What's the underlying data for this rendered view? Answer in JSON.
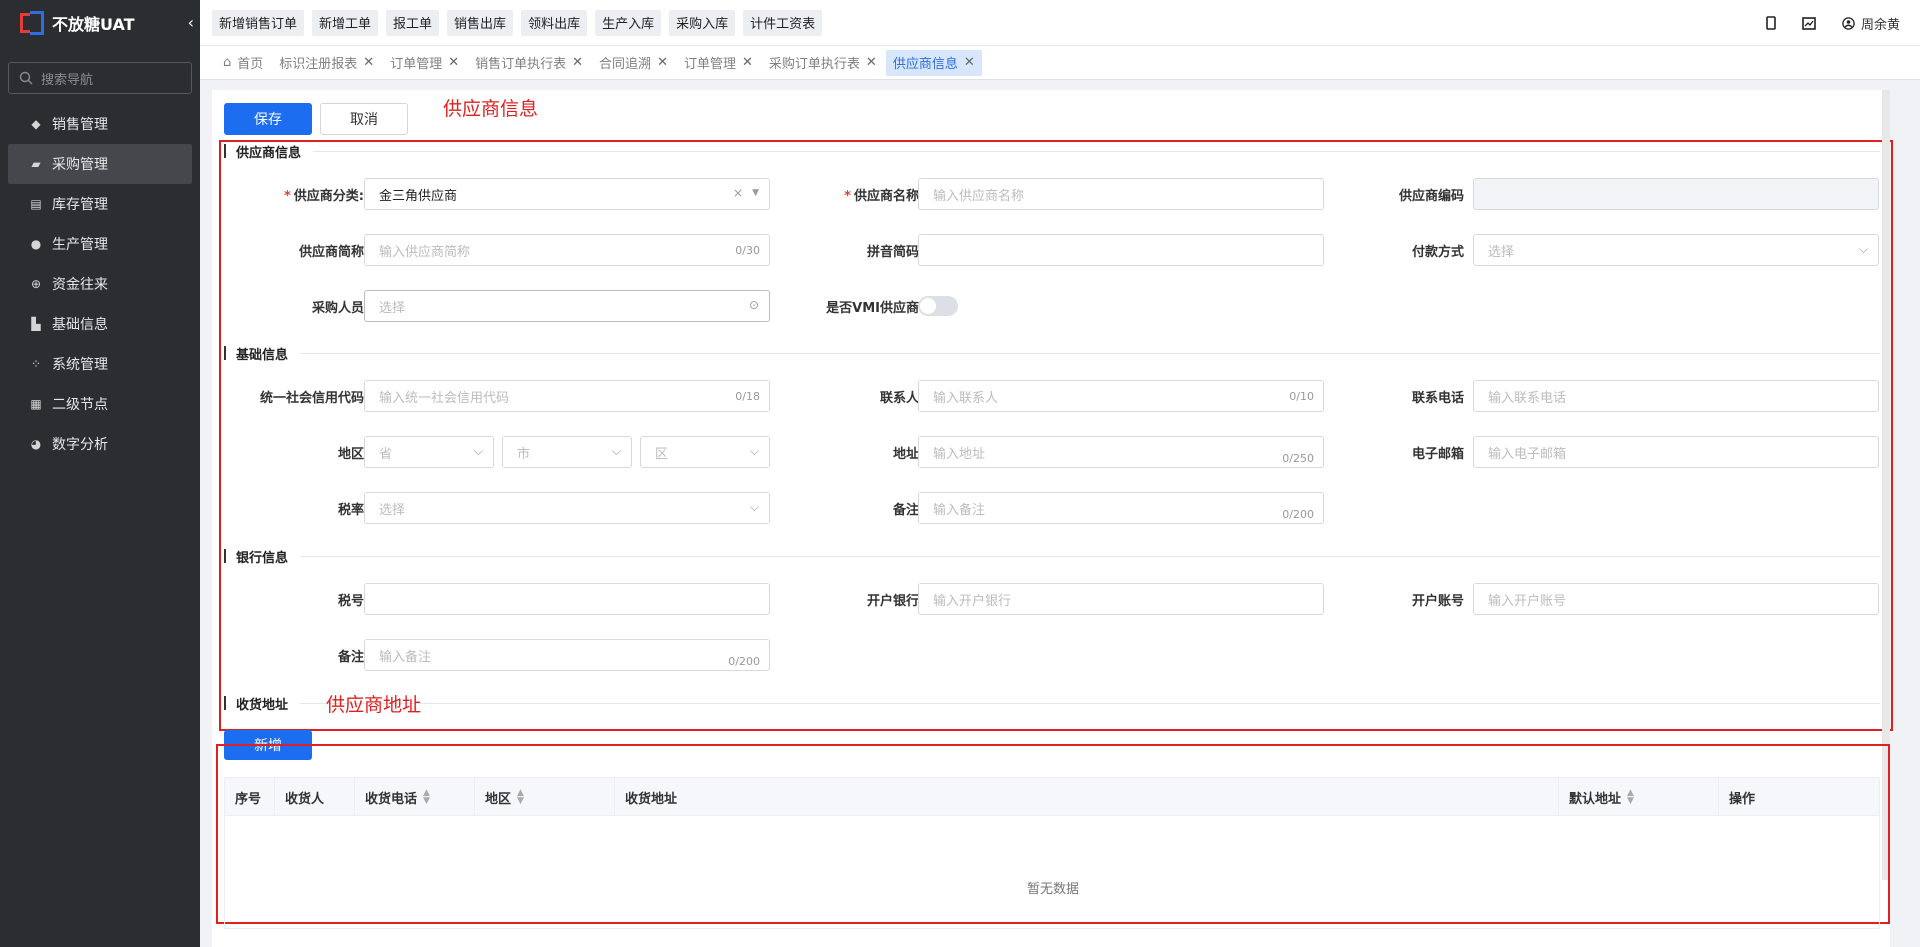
{
  "sidebar": {
    "logo_text": "不放糖UAT",
    "collapse_icon": "‹",
    "search_placeholder": "搜索导航",
    "items": [
      {
        "label": "销售管理",
        "icon": "tag-icon"
      },
      {
        "label": "采购管理",
        "icon": "cart-icon",
        "active": true
      },
      {
        "label": "库存管理",
        "icon": "warehouse-icon"
      },
      {
        "label": "生产管理",
        "icon": "production-icon"
      },
      {
        "label": "资金往来",
        "icon": "money-icon"
      },
      {
        "label": "基础信息",
        "icon": "chart-icon"
      },
      {
        "label": "系统管理",
        "icon": "grid-icon"
      },
      {
        "label": "二级节点",
        "icon": "document-icon"
      },
      {
        "label": "数字分析",
        "icon": "pie-icon"
      }
    ]
  },
  "topbar": {
    "quick_buttons": [
      "新增销售订单",
      "新增工单",
      "报工单",
      "销售出库",
      "领料出库",
      "生产入库",
      "采购入库",
      "计件工资表"
    ],
    "user_name": "周余黄"
  },
  "tabs": [
    {
      "label": "首页",
      "closable": false
    },
    {
      "label": "标识注册报表",
      "closable": true
    },
    {
      "label": "订单管理",
      "closable": true
    },
    {
      "label": "销售订单执行表",
      "closable": true
    },
    {
      "label": "合同追溯",
      "closable": true
    },
    {
      "label": "订单管理",
      "closable": true
    },
    {
      "label": "采购订单执行表",
      "closable": true
    },
    {
      "label": "供应商信息",
      "closable": true,
      "active": true
    }
  ],
  "toolbar": {
    "save_label": "保存",
    "cancel_label": "取消"
  },
  "annotations": {
    "top": "供应商信息",
    "address": "供应商地址"
  },
  "sections": {
    "supplier": "供应商信息",
    "basic": "基础信息",
    "bank": "银行信息",
    "address": "收货地址"
  },
  "form": {
    "category": {
      "label": "供应商分类:",
      "value": "金三角供应商",
      "clear": "×"
    },
    "name": {
      "label": "供应商名称",
      "placeholder": "输入供应商名称"
    },
    "code": {
      "label": "供应商编码"
    },
    "short_name": {
      "label": "供应商简称",
      "placeholder": "输入供应商简称",
      "count": "0/30"
    },
    "pinyin": {
      "label": "拼音简码"
    },
    "payment": {
      "label": "付款方式",
      "placeholder": "选择"
    },
    "buyer": {
      "label": "采购人员",
      "placeholder": "选择"
    },
    "vmi": {
      "label": "是否VMI供应商",
      "value": false
    },
    "credit_code": {
      "label": "统一社会信用代码",
      "placeholder": "输入统一社会信用代码",
      "count": "0/18"
    },
    "contact": {
      "label": "联系人",
      "placeholder": "输入联系人",
      "count": "0/10"
    },
    "phone": {
      "label": "联系电话",
      "placeholder": "输入联系电话"
    },
    "region": {
      "label": "地区",
      "province": "省",
      "city": "市",
      "district": "区"
    },
    "address": {
      "label": "地址",
      "placeholder": "输入地址",
      "count": "0/250"
    },
    "email": {
      "label": "电子邮箱",
      "placeholder": "输入电子邮箱"
    },
    "tax_rate": {
      "label": "税率",
      "placeholder": "选择"
    },
    "remark": {
      "label": "备注",
      "placeholder": "输入备注",
      "count": "0/200"
    },
    "tax_no": {
      "label": "税号"
    },
    "bank": {
      "label": "开户银行",
      "placeholder": "输入开户银行"
    },
    "account": {
      "label": "开户账号",
      "placeholder": "输入开户账号"
    },
    "bank_remark": {
      "label": "备注",
      "placeholder": "输入备注",
      "count": "0/200"
    }
  },
  "address_table": {
    "add_label": "新增",
    "columns": [
      "序号",
      "收货人",
      "收货电话",
      "地区",
      "收货地址",
      "默认地址",
      "操作"
    ],
    "rows": [],
    "empty_text": "暂无数据"
  },
  "colors": {
    "primary": "#1d6df0",
    "sidebar": "#2b2d31",
    "annotation": "#e02020"
  }
}
